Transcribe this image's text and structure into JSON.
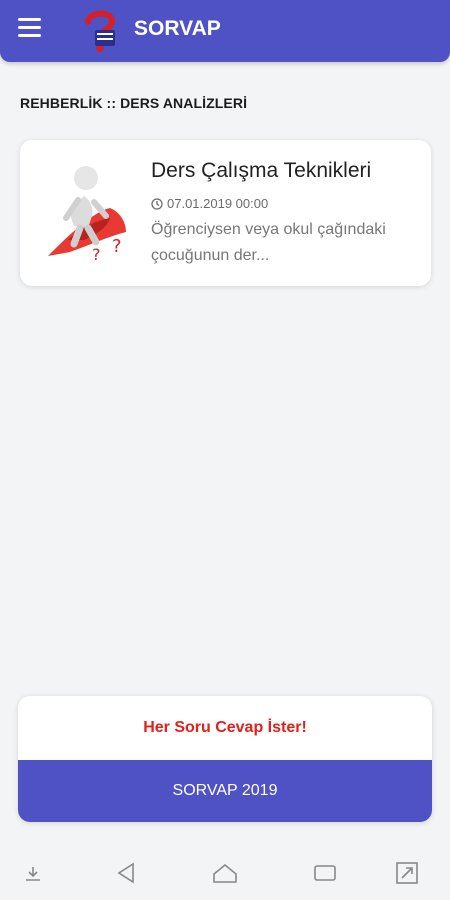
{
  "app_title": "SORVAP",
  "breadcrumb": "REHBERLİK :: DERS ANALİZLERİ",
  "article": {
    "title": "Ders Çalışma Teknikleri",
    "date": "07.01.2019 00:00",
    "excerpt": "Öğrenciysen veya okul çağındaki çocuğunun der..."
  },
  "footer": {
    "slogan": "Her Soru Cevap İster!",
    "button_label": "SORVAP 2019"
  },
  "colors": {
    "primary": "#4e52c4",
    "accent_red": "#e3201b",
    "background": "#f3f4f6"
  },
  "icons": {
    "menu": "hamburger-menu-icon",
    "clock": "clock-icon",
    "nav": [
      "keyboard-hide-icon",
      "back-icon",
      "home-icon",
      "recents-icon",
      "rotate-icon"
    ]
  }
}
